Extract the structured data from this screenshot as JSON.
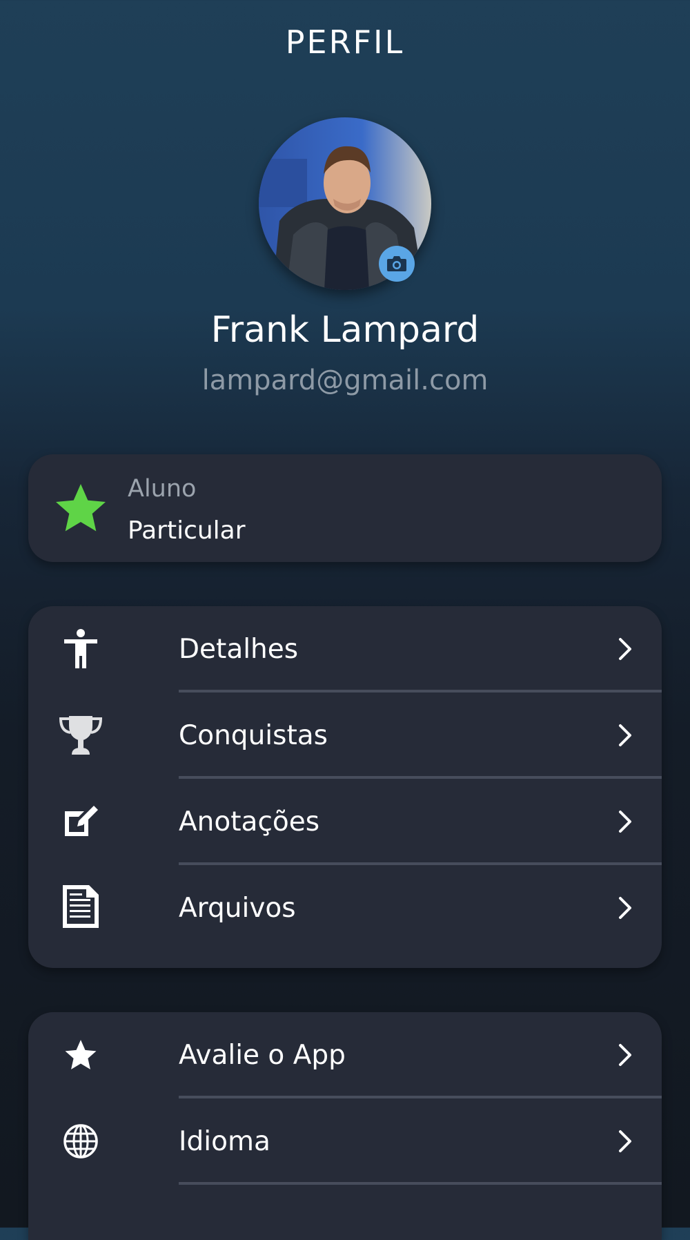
{
  "header": {
    "title": "PERFIL"
  },
  "profile": {
    "name": "Frank Lampard",
    "email": "lampard@gmail.com",
    "avatar_icon": "user-photo",
    "camera_icon": "camera-icon"
  },
  "role_card": {
    "label": "Aluno",
    "value": "Particular",
    "icon": "star-icon",
    "icon_color": "#5fd447"
  },
  "menu_main": [
    {
      "label": "Detalhes",
      "icon": "person-icon"
    },
    {
      "label": "Conquistas",
      "icon": "trophy-icon"
    },
    {
      "label": "Anotações",
      "icon": "edit-note-icon"
    },
    {
      "label": "Arquivos",
      "icon": "document-icon"
    }
  ],
  "menu_secondary": [
    {
      "label": "Avalie o App",
      "icon": "star-icon"
    },
    {
      "label": "Idioma",
      "icon": "globe-icon"
    }
  ],
  "colors": {
    "card_bg": "#262b38",
    "divider": "#474d5c",
    "camera_badge": "#5aa6e6",
    "email_text": "#8e9aa6"
  }
}
